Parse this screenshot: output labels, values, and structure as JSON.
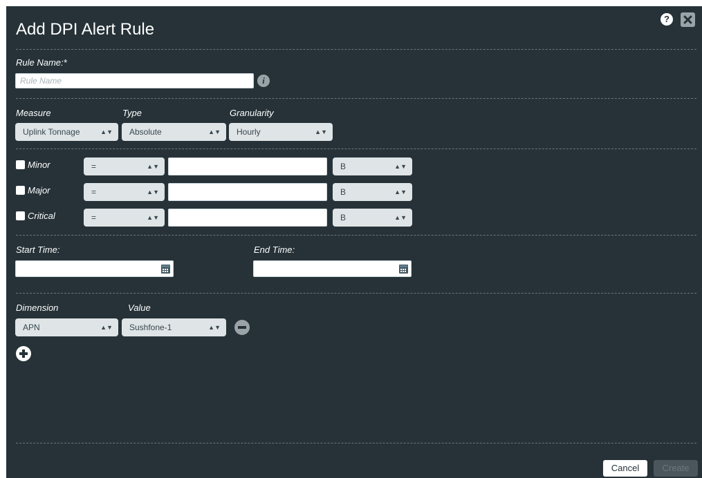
{
  "dialog": {
    "title": "Add DPI Alert Rule",
    "help_icon": "?",
    "close_icon": "close"
  },
  "rule_name": {
    "label": "Rule Name:*",
    "placeholder": "Rule Name",
    "value": "",
    "info_icon": "i"
  },
  "measure": {
    "label": "Measure",
    "selected": "Uplink Tonnage"
  },
  "type": {
    "label": "Type",
    "selected": "Absolute"
  },
  "granularity": {
    "label": "Granularity",
    "selected": "Hourly"
  },
  "thresholds": [
    {
      "label": "Minor",
      "checked": false,
      "operator": "=",
      "value": "",
      "unit": "B"
    },
    {
      "label": "Major",
      "checked": false,
      "operator": "=",
      "value": "",
      "unit": "B"
    },
    {
      "label": "Critical",
      "checked": false,
      "operator": "=",
      "value": "",
      "unit": "B"
    }
  ],
  "start_time": {
    "label": "Start Time:",
    "value": ""
  },
  "end_time": {
    "label": "End Time:",
    "value": ""
  },
  "dimension": {
    "label": "Dimension",
    "selected": "APN"
  },
  "value": {
    "label": "Value",
    "selected": "Sushfone-1"
  },
  "buttons": {
    "cancel": "Cancel",
    "create": "Create"
  },
  "colors": {
    "background": "#263238",
    "select_bg": "#dfe4e6",
    "disabled_button": "#4a565c"
  }
}
